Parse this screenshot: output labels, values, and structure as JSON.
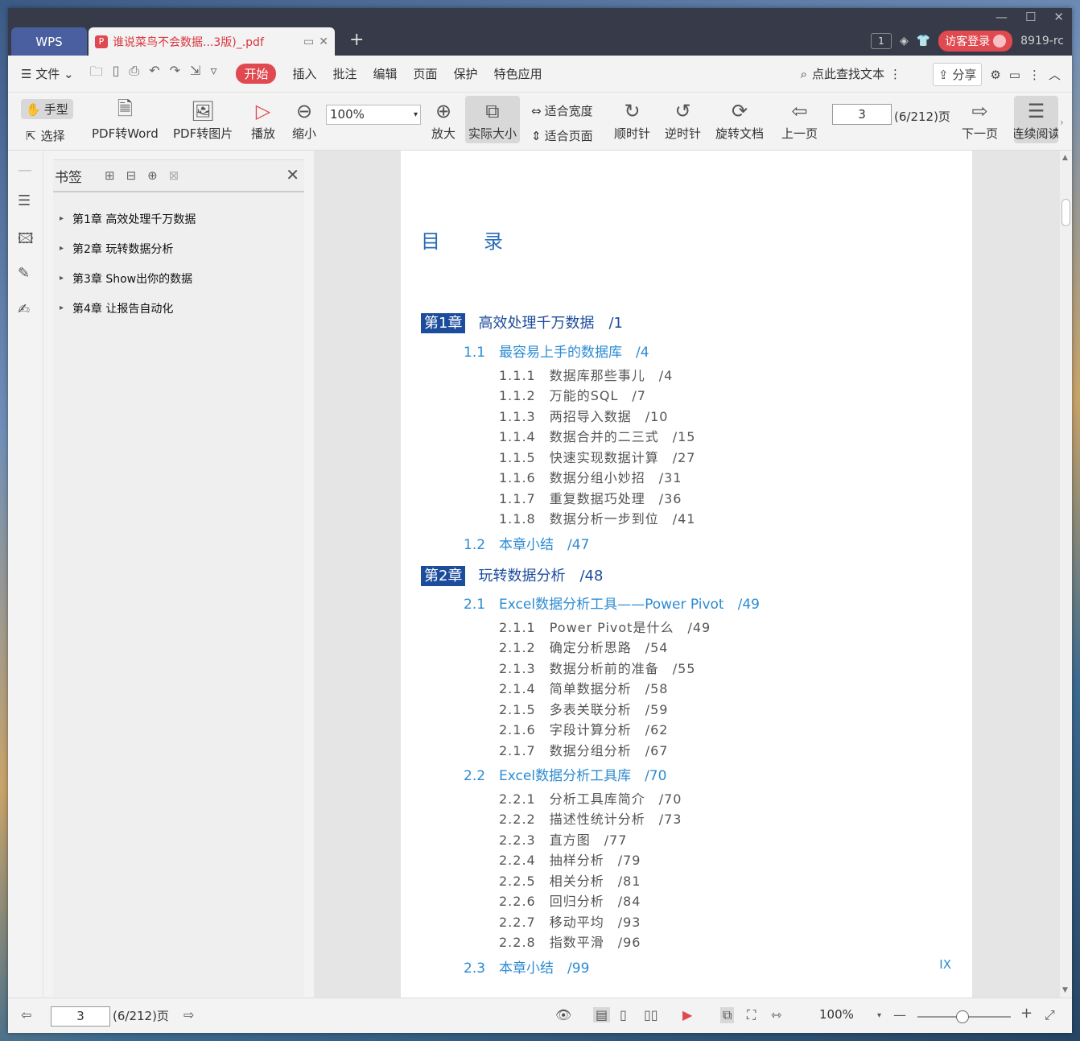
{
  "titlebar": {
    "app": "WPS",
    "doc_tab": "谁说菜鸟不会数据...3版)_.pdf",
    "page_badge": "1",
    "login": "访客登录",
    "user": "8919-rc"
  },
  "menu": {
    "file": "文件",
    "tabs": [
      "开始",
      "插入",
      "批注",
      "编辑",
      "页面",
      "保护",
      "特色应用"
    ],
    "search": "点此查找文本",
    "share": "分享"
  },
  "toolbar": {
    "hand": "手型",
    "select": "选择",
    "pdf2word": "PDF转Word",
    "pdf2img": "PDF转图片",
    "play": "播放",
    "zoom_out": "缩小",
    "zoom_value": "100%",
    "zoom_in": "放大",
    "actual_size": "实际大小",
    "fit_width": "适合宽度",
    "fit_page": "适合页面",
    "clockwise": "顺时针",
    "counter": "逆时针",
    "rotate_doc": "旋转文档",
    "prev": "上一页",
    "page": "3",
    "page_total": "(6/212)页",
    "next": "下一页",
    "continuous": "连续阅读"
  },
  "bookmarks": {
    "title": "书签",
    "items": [
      "第1章 高效处理千万数据",
      "第2章 玩转数据分析",
      "第3章 Show出你的数据",
      "第4章 让报告自动化"
    ]
  },
  "toc": {
    "title": "目　　录",
    "page_number": "IX",
    "ch1": {
      "box": "第1章",
      "title": "高效处理千万数据　/1"
    },
    "s1_1": "1.1　最容易上手的数据库　/4",
    "s1_1_items": [
      "1.1.1　数据库那些事儿　/4",
      "1.1.2　万能的SQL　/7",
      "1.1.3　两招导入数据　/10",
      "1.1.4　数据合并的二三式　/15",
      "1.1.5　快速实现数据计算　/27",
      "1.1.6　数据分组小妙招　/31",
      "1.1.7　重复数据巧处理　/36",
      "1.1.8　数据分析一步到位　/41"
    ],
    "s1_2": "1.2　本章小结　/47",
    "ch2": {
      "box": "第2章",
      "title": "玩转数据分析　/48"
    },
    "s2_1": "2.1　Excel数据分析工具——Power Pivot　/49",
    "s2_1_items": [
      "2.1.1　Power Pivot是什么　/49",
      "2.1.2　确定分析思路　/54",
      "2.1.3　数据分析前的准备　/55",
      "2.1.4　简单数据分析　/58",
      "2.1.5　多表关联分析　/59",
      "2.1.6　字段计算分析　/62",
      "2.1.7　数据分组分析　/67"
    ],
    "s2_2": "2.2　Excel数据分析工具库　/70",
    "s2_2_items": [
      "2.2.1　分析工具库简介　/70",
      "2.2.2　描述性统计分析　/73",
      "2.2.3　直方图　/77",
      "2.2.4　抽样分析　/79",
      "2.2.5　相关分析　/81",
      "2.2.6　回归分析　/84",
      "2.2.7　移动平均　/93",
      "2.2.8　指数平滑　/96"
    ],
    "s2_3": "2.3　本章小结　/99"
  },
  "statusbar": {
    "page": "3",
    "page_total": "(6/212)页",
    "zoom": "100%"
  }
}
